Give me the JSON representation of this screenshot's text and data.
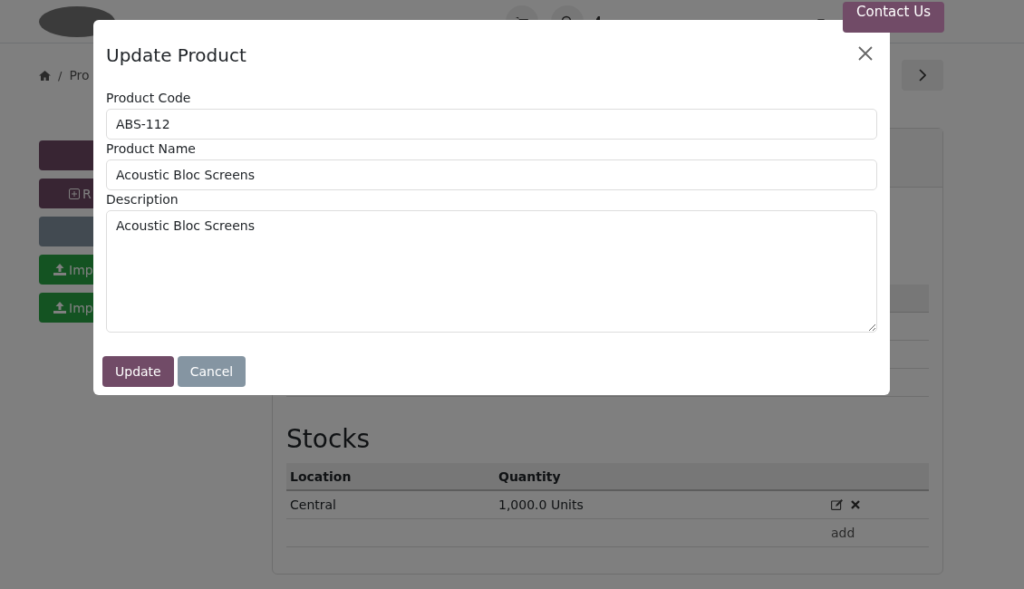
{
  "navbar": {
    "cta": "Contact Us"
  },
  "breadcrumb": {
    "separator": "/",
    "items": [
      "Pro"
    ]
  },
  "side_buttons": [
    {
      "kind": "primary"
    },
    {
      "kind": "primary-add",
      "label": "R"
    },
    {
      "kind": "secondary"
    },
    {
      "kind": "success-upload",
      "label": "Imp"
    },
    {
      "kind": "success-upload",
      "label": "Imp"
    }
  ],
  "stocks": {
    "title": "Stocks",
    "columns": [
      "Location",
      "Quantity"
    ],
    "rows": [
      {
        "location": "Central",
        "quantity": "1,000.0 Units"
      }
    ],
    "add_link": "add"
  },
  "modal": {
    "title": "Update Product",
    "fields": [
      {
        "kind": "input",
        "label": "Product Code",
        "value": "ABS-112"
      },
      {
        "kind": "input",
        "label": "Product Name",
        "value": "Acoustic Bloc Screens"
      },
      {
        "kind": "textarea",
        "label": "Description",
        "value": "Acoustic Bloc Screens"
      }
    ],
    "buttons": [
      {
        "kind": "primary",
        "label": "Update"
      },
      {
        "kind": "secondary",
        "label": "Cancel"
      }
    ]
  }
}
